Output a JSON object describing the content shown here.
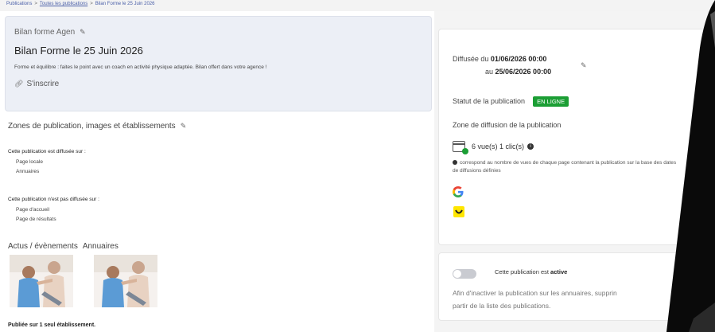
{
  "breadcrumb": [
    "Publications",
    "Toutes les publications",
    "Bilan Forme le 25 Juin 2026"
  ],
  "header_card": {
    "subtitle": "Bilan forme Agen",
    "title": "Bilan Forme le 25 Juin 2026",
    "description": "Forme et équilibre : faites le point avec un coach en activité physique adaptée. Bilan offert dans votre agence !",
    "link": "S'inscrire"
  },
  "zones": {
    "title": "Zones de publication, images et établissements",
    "diffused_label": "Cette publication est diffusée sur :",
    "diffused_items": [
      "Page locale",
      "Annuaires"
    ],
    "not_diffused_label": "Cette publication n'est pas diffusée sur :",
    "not_diffused_items": [
      "Page d'accueil",
      "Page de résultats"
    ]
  },
  "image_tabs": [
    "Actus / évènements",
    "Annuaires"
  ],
  "published_on": "Publiée sur 1 seul établissement.",
  "diffusion": {
    "from_prefix": "Diffusée du ",
    "from_date": "01/06/2026 00:00",
    "to_prefix": "au ",
    "to_date": "25/06/2026 00:00",
    "status_label": "Statut de la publication",
    "status_badge": "EN LIGNE",
    "zone_label": "Zone de diffusion de la publication",
    "views": "6 vue(s) 1 clic(s)",
    "note": "correspond au nombre de vues de chaque page contenant la publication sur la base des dates de diffusions définies"
  },
  "activation": {
    "label_prefix": "Cette publication est ",
    "label_bold": "active",
    "desc_line1": "Afin d'inactiver la publication sur les annuaires, supprin",
    "desc_line2": "partir de la liste des publications."
  },
  "colors": {
    "badge_green": "#1b9e34",
    "link_blue": "#4a5fa8",
    "google_yellow_icon": "#ffe600"
  },
  "icons": [
    "pencil-icon",
    "link-icon",
    "calendar-check-icon",
    "info-icon",
    "google-icon",
    "pagesjaunes-icon",
    "toggle-switch"
  ]
}
